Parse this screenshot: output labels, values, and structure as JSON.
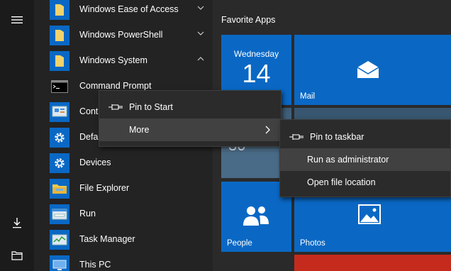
{
  "start_menu": {
    "rail": {
      "items": [
        {
          "icon": "hamburger-menu-icon"
        },
        {
          "icon": "downloads-icon"
        },
        {
          "icon": "file-explorer-icon"
        }
      ]
    },
    "app_list": {
      "items": [
        {
          "label": "Windows Ease of Access",
          "icon": "folder-icon",
          "chevron": "chevron-down-icon"
        },
        {
          "label": "Windows PowerShell",
          "icon": "folder-icon",
          "chevron": "chevron-down-icon"
        },
        {
          "label": "Windows System",
          "icon": "folder-icon",
          "chevron": "chevron-up-icon"
        },
        {
          "label": "Command Prompt",
          "icon": "command-prompt-icon"
        },
        {
          "label": "Control Panel",
          "icon": "control-panel-icon"
        },
        {
          "label": "Default Programs",
          "icon": "gear-icon"
        },
        {
          "label": "Devices",
          "icon": "gear-icon"
        },
        {
          "label": "File Explorer",
          "icon": "file-explorer-icon"
        },
        {
          "label": "Run",
          "icon": "run-icon"
        },
        {
          "label": "Task Manager",
          "icon": "task-manager-icon"
        },
        {
          "label": "This PC",
          "icon": "this-pc-icon"
        }
      ]
    },
    "tiles": {
      "section_title": "Favorite Apps",
      "calendar": {
        "day": "Wednesday",
        "date": "14"
      },
      "mail": {
        "label": "Mail"
      },
      "weather": {
        "temp": "30"
      },
      "people": {
        "label": "People"
      },
      "photos": {
        "label": "Photos"
      }
    }
  },
  "context_menu": {
    "items": [
      {
        "label": "Pin to Start",
        "icon": "pin-icon"
      },
      {
        "label": "More",
        "icon": "chevron-right-icon"
      }
    ]
  },
  "submenu": {
    "items": [
      {
        "label": "Pin to taskbar",
        "icon": "pin-icon"
      },
      {
        "label": "Run as administrator"
      },
      {
        "label": "Open file location"
      }
    ]
  },
  "colors": {
    "accent": "#0a68c4",
    "menu_background": "#2b2b2b",
    "hover": "#414141",
    "list_background": "#232323"
  }
}
